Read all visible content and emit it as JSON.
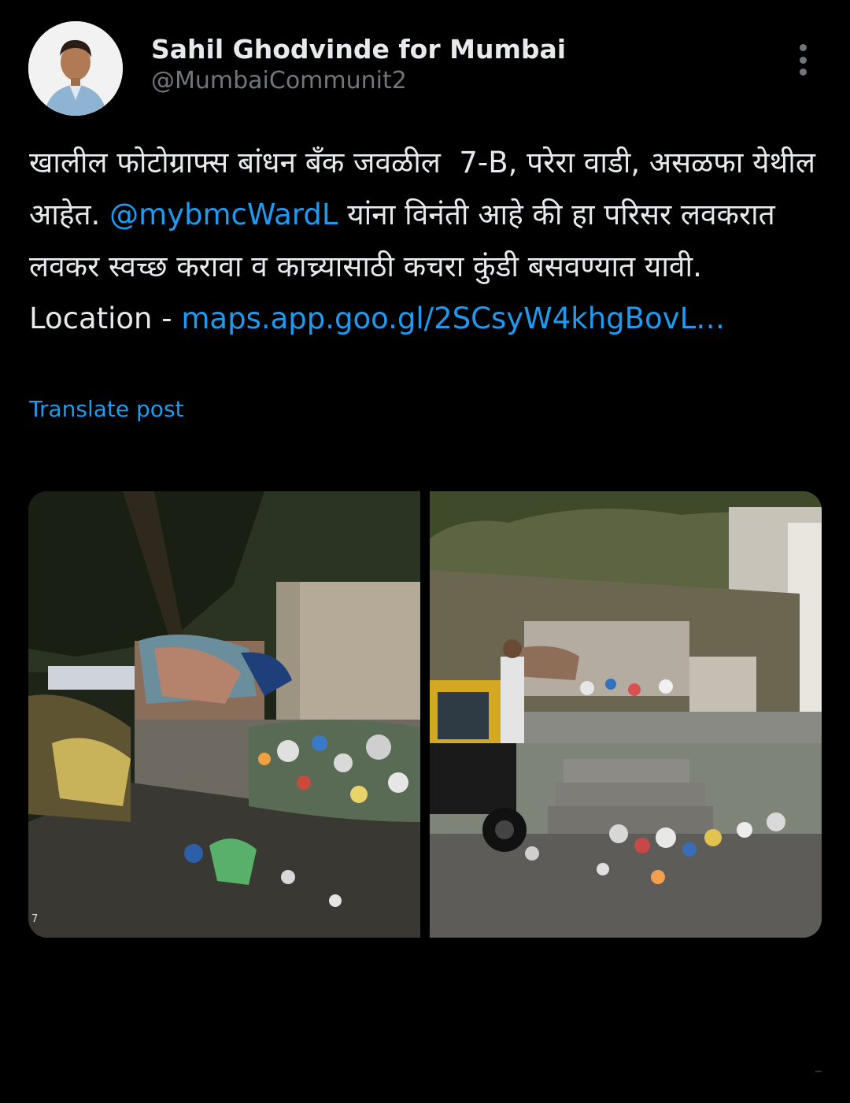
{
  "author": {
    "name": "Sahil Ghodvinde for Mumbai",
    "handle": "@MumbaiCommunit2"
  },
  "post": {
    "text_part1": "खालील फोटोग्राफ्स बांधन बँक जवळील  7-B, परेरा वाडी, असळफा येथील आहेत. ",
    "mention": "@mybmcWardL",
    "text_part2": " यांना विनंती आहे की हा परिसर लवकरात लवकर स्वच्छ करावा व काच्र्यासाठी कचरा कुंडी बसवण्यात यावी.",
    "location_label": "Location - ",
    "location_link": "maps.app.goo.gl/2SCsyW4khgBovL…"
  },
  "actions": {
    "translate_label": "Translate post"
  },
  "media": {
    "photo1_tag": "7"
  }
}
